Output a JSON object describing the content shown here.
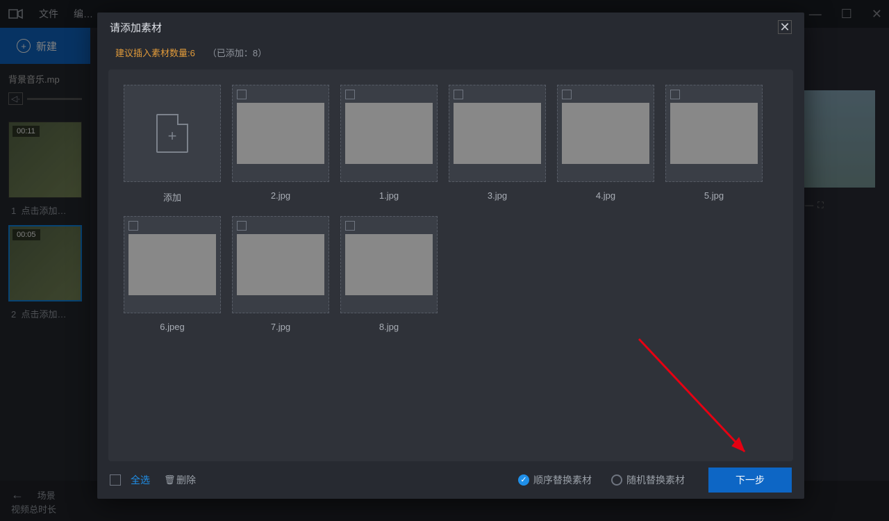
{
  "app": {
    "menu": {
      "file": "文件",
      "edit": "编…"
    },
    "new_button": "新建",
    "audio_file": "背景音乐.mp",
    "thumbs": [
      {
        "time": "00:11",
        "label": "点击添加…",
        "index": "1"
      },
      {
        "time": "00:05",
        "label": "点击添加…",
        "index": "2"
      }
    ],
    "bottom": {
      "scene": "场景",
      "duration": "视频总时长"
    }
  },
  "modal": {
    "title": "请添加素材",
    "hint_prefix": "建议插入素材数量:",
    "hint_count": "6",
    "added_prefix": "（已添加：",
    "added_count": "8",
    "added_suffix": "）",
    "add_tile_label": "添加",
    "items": [
      {
        "label": "2.jpg",
        "cls": "img-2"
      },
      {
        "label": "1.jpg",
        "cls": "img-1"
      },
      {
        "label": "3.jpg",
        "cls": "img-3"
      },
      {
        "label": "4.jpg",
        "cls": "img-4"
      },
      {
        "label": "5.jpg",
        "cls": "img-5"
      },
      {
        "label": "6.jpeg",
        "cls": "img-6"
      },
      {
        "label": "7.jpg",
        "cls": "img-7"
      },
      {
        "label": "8.jpg",
        "cls": "img-8"
      }
    ],
    "footer": {
      "select_all": "全选",
      "delete": "删除",
      "order_replace": "顺序替换素材",
      "random_replace": "随机替换素材",
      "next": "下一步"
    }
  }
}
